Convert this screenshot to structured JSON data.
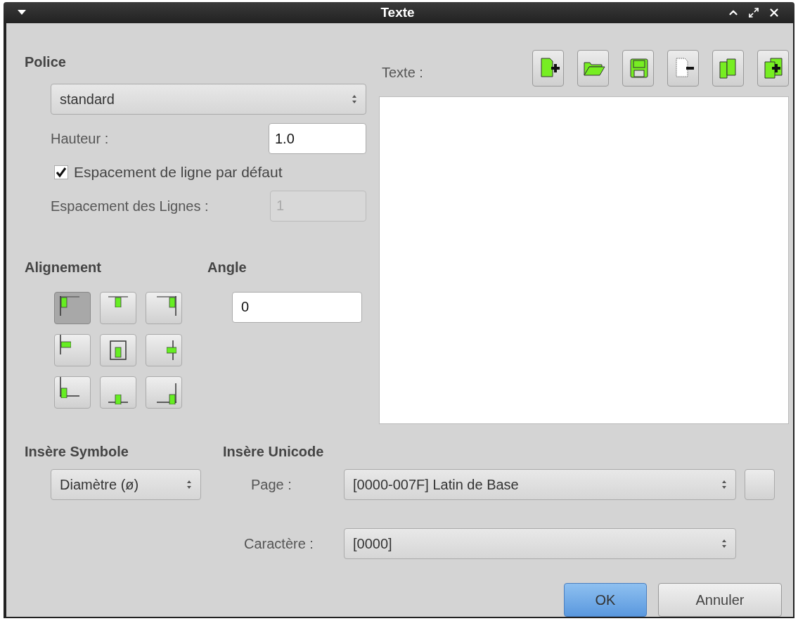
{
  "window": {
    "title": "Texte"
  },
  "font": {
    "heading": "Police",
    "family": "standard",
    "height_label": "Hauteur :",
    "height_value": "1.0",
    "default_spacing": {
      "label": "Espacement de ligne par défaut",
      "checked": true
    },
    "spacing_label": "Espacement des Lignes :",
    "spacing": {
      "value": "1",
      "disabled": true
    }
  },
  "alignment": {
    "heading": "Alignement",
    "buttons": [
      {
        "selected": true
      },
      {
        "selected": false
      },
      {
        "selected": false
      },
      {
        "selected": false
      },
      {
        "selected": false
      },
      {
        "selected": false
      },
      {
        "selected": false
      },
      {
        "selected": false
      },
      {
        "selected": false
      }
    ]
  },
  "angle": {
    "heading": "Angle",
    "value": "0"
  },
  "text": {
    "label": "Texte :"
  },
  "symbol": {
    "heading": "Insère Symbole",
    "value": "Diamètre (ø)"
  },
  "unicode": {
    "heading": "Insère Unicode",
    "page_label": "Page :",
    "page": "[0000-007F] Latin de Base",
    "char_label": "Caractère :",
    "char": "[0000]"
  },
  "buttons": [
    {
      "label": "OK",
      "default": true
    },
    {
      "label": "Annuler",
      "default": false
    }
  ]
}
